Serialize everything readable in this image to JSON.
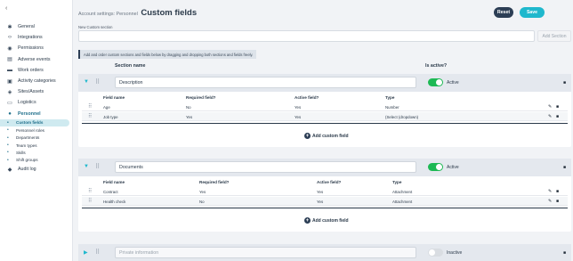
{
  "sidebar": {
    "collapse_icon": "‹",
    "items": [
      {
        "label": "General",
        "icon": "gear-icon"
      },
      {
        "label": "Integrations",
        "icon": "code-icon"
      },
      {
        "label": "Permissions",
        "icon": "shield-icon"
      },
      {
        "label": "Adverse events",
        "icon": "list-icon"
      },
      {
        "label": "Work orders",
        "icon": "folder-icon"
      },
      {
        "label": "Activity categories",
        "icon": "clipboard-icon"
      },
      {
        "label": "Sites/Assets",
        "icon": "compass-icon"
      },
      {
        "label": "Logistics",
        "icon": "truck-icon"
      }
    ],
    "personnel": {
      "label": "Personnel",
      "icon": "person-icon"
    },
    "sub_items": [
      "Custom fields",
      "Personnel roles",
      "Departments",
      "Team types",
      "Skills",
      "Shift groups"
    ],
    "audit": {
      "label": "Audit log",
      "icon": "shield-check-icon"
    }
  },
  "header": {
    "breadcrumb": "Account settings: Personnel",
    "title": "Custom fields",
    "reset_label": "Reset",
    "save_label": "Save"
  },
  "new_section": {
    "label": "New Custom section",
    "value": "",
    "add_label": "Add Section"
  },
  "hint": "Add and order custom sections and fields below by dragging and dropping both sections and fields freely.",
  "columns": {
    "section_name": "Section name",
    "is_active": "Is active?"
  },
  "field_columns": [
    "Field name",
    "Required field?",
    "Active field?",
    "Type"
  ],
  "sections": [
    {
      "name": "Description",
      "active": true,
      "status": "Active",
      "fields": [
        {
          "name": "Age",
          "required": "No",
          "active": "Yes",
          "type": "Number"
        },
        {
          "name": "Job type",
          "required": "Yes",
          "active": "Yes",
          "type": "(Select (dropdown)"
        }
      ],
      "add_field_label": "Add custom field"
    },
    {
      "name": "Documents",
      "active": true,
      "status": "Active",
      "fields": [
        {
          "name": "Contract",
          "required": "Yes",
          "active": "Yes",
          "type": "Attachment"
        },
        {
          "name": "Health check",
          "required": "No",
          "active": "Yes",
          "type": "Attachment"
        }
      ],
      "add_field_label": "Add custom field"
    },
    {
      "name": "Private information",
      "active": false,
      "status": "Inactive"
    }
  ],
  "colors": {
    "accent": "#1fb8cd",
    "navy": "#2c3e55",
    "toggle_on": "#1db954"
  }
}
